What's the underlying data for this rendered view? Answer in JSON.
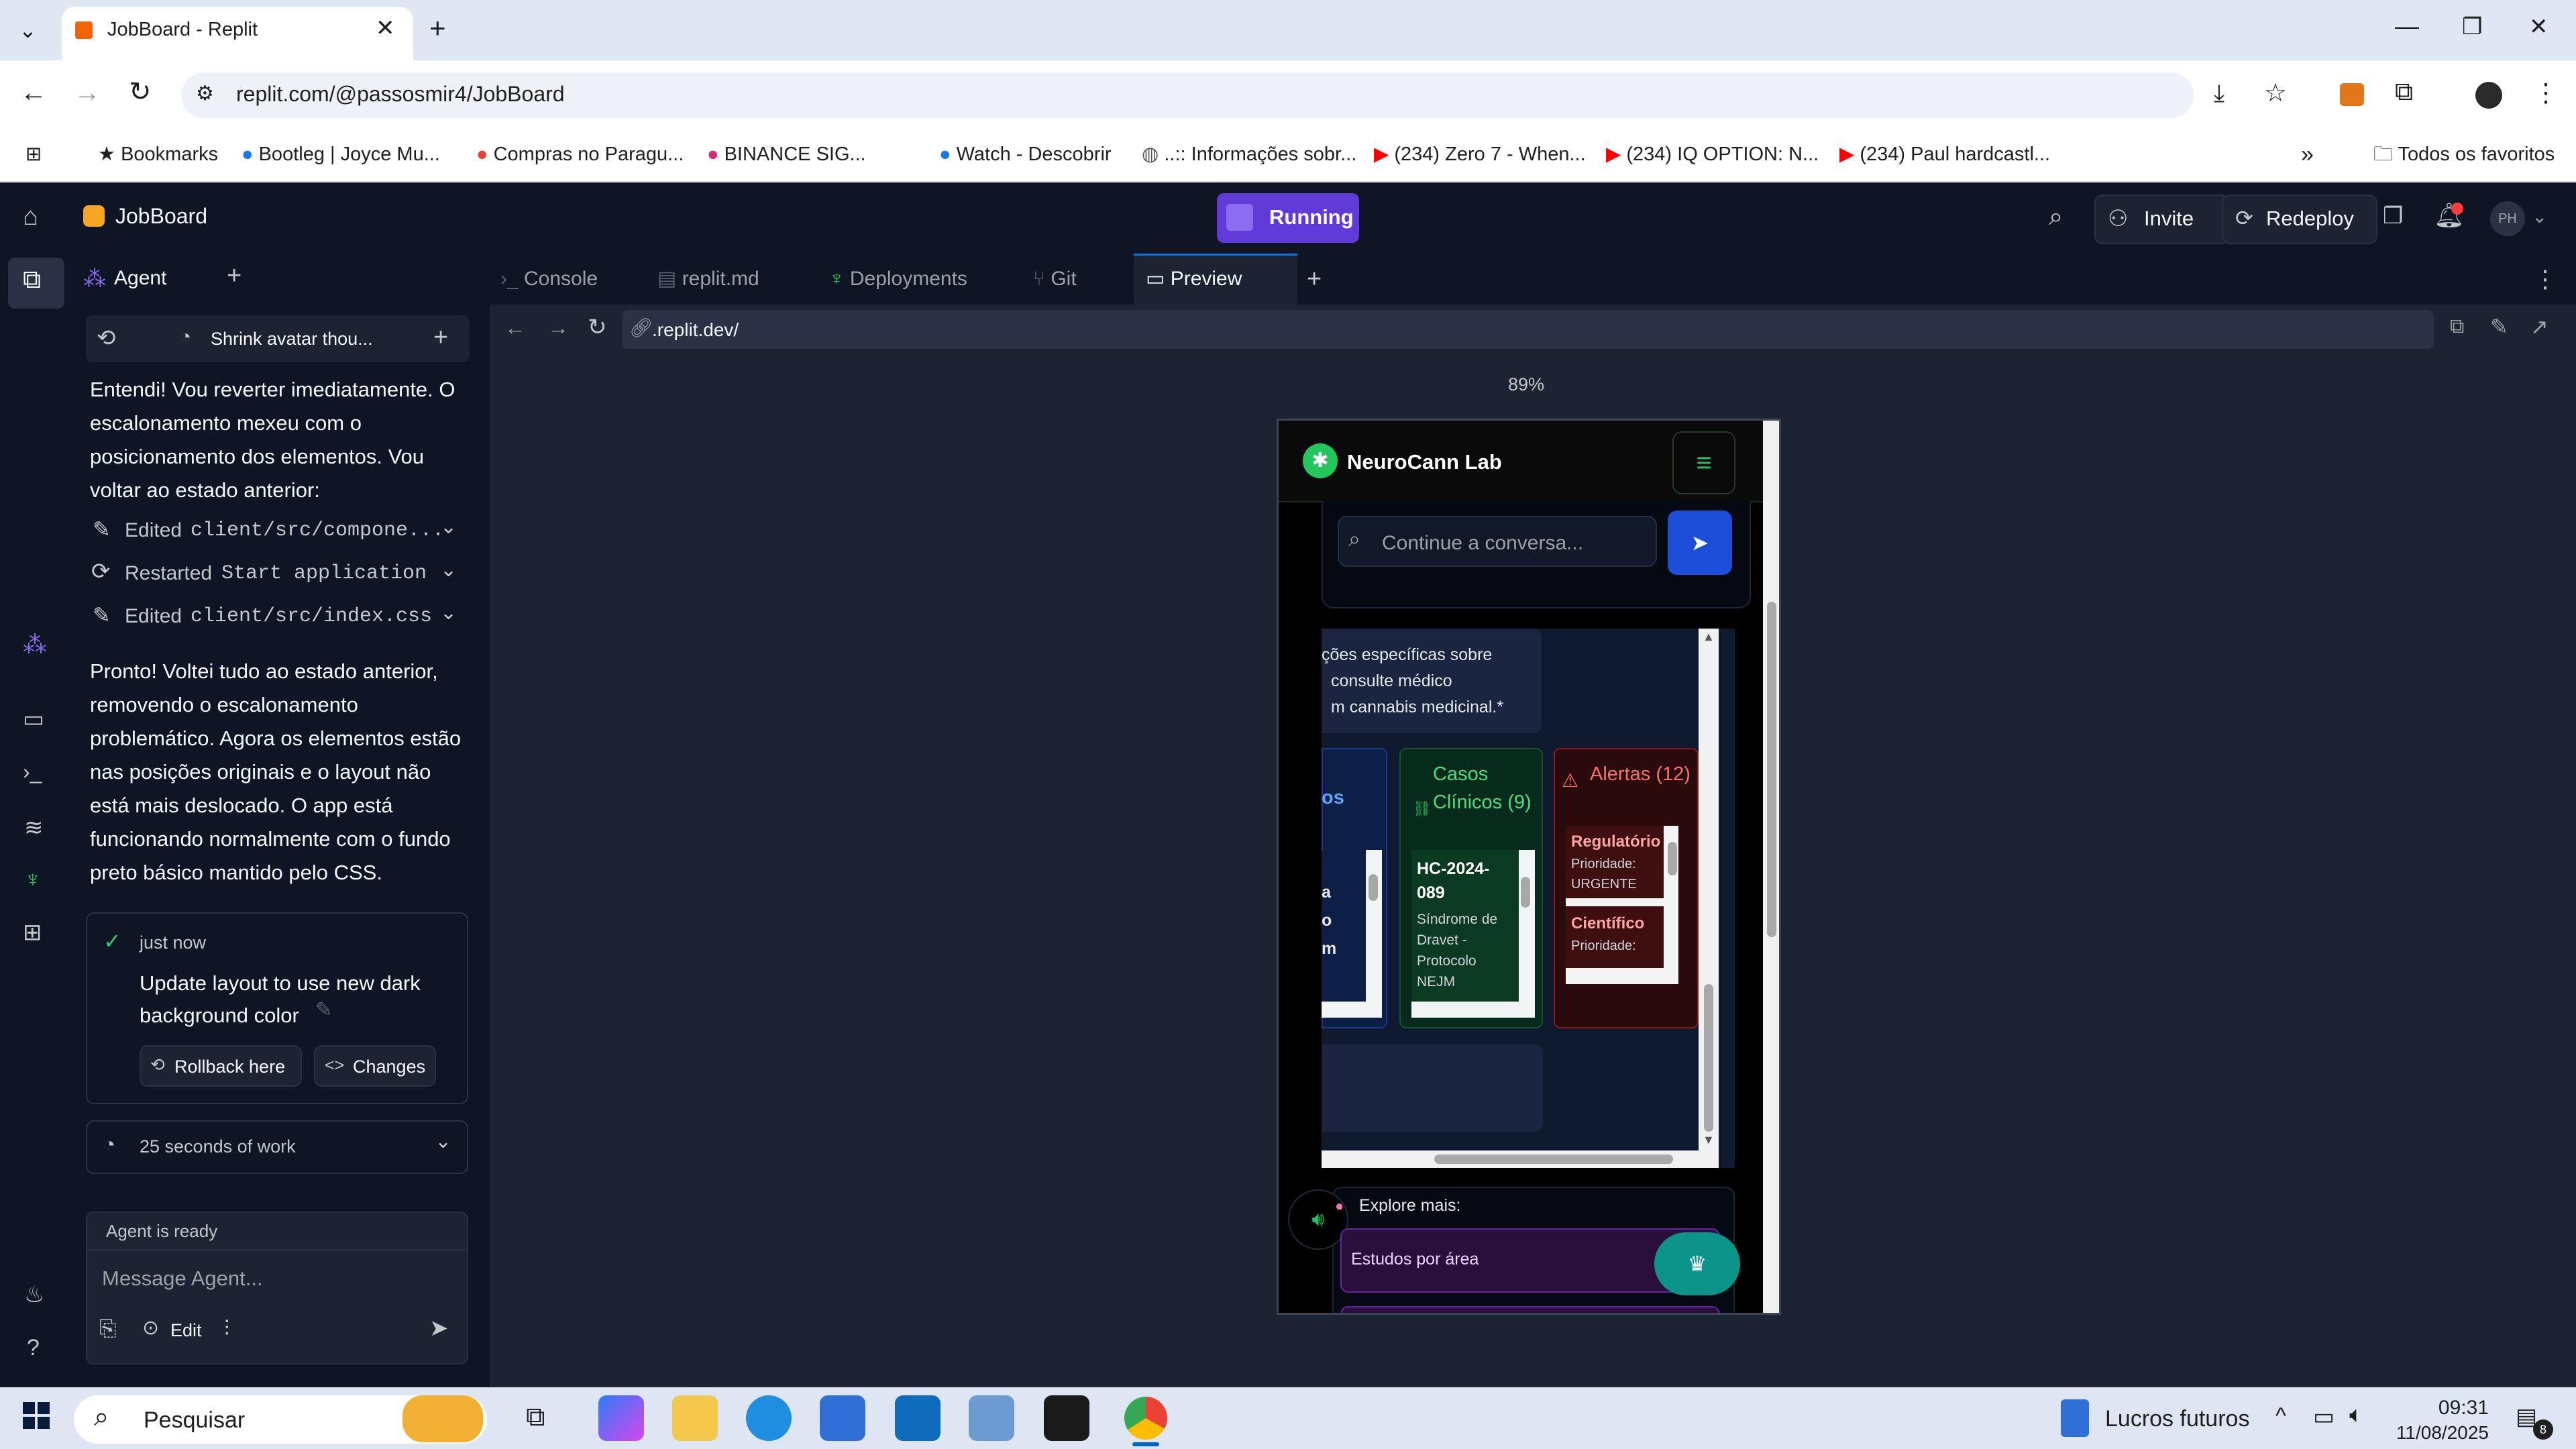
{
  "browser": {
    "tab_title": "JobBoard - Replit",
    "url": "replit.com/@passosmir4/JobBoard",
    "bookmarks": [
      "Bookmarks",
      "Bootleg | Joyce Mu...",
      "Compras no Paragu...",
      "BINANCE SIG...",
      "Watch - Descobrir",
      "..:: Informações sobr...",
      "(234) Zero 7 - When...",
      "(234) IQ OPTION: N...",
      "(234) Paul hardcastl..."
    ],
    "all_bookmarks": "Todos os favoritos"
  },
  "replit": {
    "project_name": "JobBoard",
    "status": "Running",
    "invite": "Invite",
    "redeploy": "Redeploy",
    "avatar_initials": "PH"
  },
  "agent": {
    "tab_label": "Agent",
    "thread_title": "Shrink avatar thou...",
    "message1": "Entendi! Vou reverter imediatamente. O escalonamento mexeu com o posicionamento dos elementos. Vou voltar ao estado anterior:",
    "actions": [
      {
        "verb": "Edited",
        "target": "client/src/compone..."
      },
      {
        "verb": "Restarted",
        "target": "Start application"
      },
      {
        "verb": "Edited",
        "target": "client/src/index.css"
      }
    ],
    "message2": "Pronto! Voltei tudo ao estado anterior, removendo o escalonamento problemático. Agora os elementos estão nas posições originais e o layout não está mais deslocado. O app está funcionando normalmente com o fundo preto básico mantido pelo CSS.",
    "checkpoint_time": "just now",
    "checkpoint_title": "Update layout to use new dark background color",
    "rollback_label": "Rollback here",
    "changes_label": "Changes",
    "work_summary": "25 seconds of work",
    "status": "Agent is ready",
    "input_placeholder": "Message Agent...",
    "edit_label": "Edit"
  },
  "panes": {
    "tabs": [
      "Console",
      "replit.md",
      "Deployments",
      "Git",
      "Preview"
    ],
    "active_tab": "Preview",
    "preview_url": ".replit.dev/",
    "zoom": "89%"
  },
  "app": {
    "brand": "NeuroCann Lab",
    "chat_placeholder": "Continue a conversa...",
    "disclaimer_lines": [
      "ções específicas sobre",
      "consulte médico",
      "m cannabis medicinal.*"
    ],
    "col1_fragment": "os",
    "col1_text": [
      "a",
      "o",
      "m"
    ],
    "cases_title": "Casos Clínicos (9)",
    "case_id": "HC-2024-089",
    "case_desc": "Síndrome de Dravet - Protocolo NEJM",
    "alerts_title": "Alertas (12)",
    "alerts": [
      {
        "title": "Regulatório",
        "line1": "Prioridade:",
        "line2": "URGENTE"
      },
      {
        "title": "Científico",
        "line1": "Prioridade:",
        "line2": ""
      }
    ],
    "explore_title": "Explore mais:",
    "explore_item": "Estudos por área"
  },
  "taskbar": {
    "search_placeholder": "Pesquisar",
    "widget_label": "Lucros futuros",
    "time": "09:31",
    "date": "11/08/2025",
    "notif_count": "8"
  },
  "colors": {
    "replit_bg": "#0e1525",
    "pane_bg": "#1c2333",
    "running_purple": "#5f3ad6",
    "app_green": "#22c55e",
    "send_blue": "#1d4ed8",
    "alert_red": "#f87171"
  }
}
